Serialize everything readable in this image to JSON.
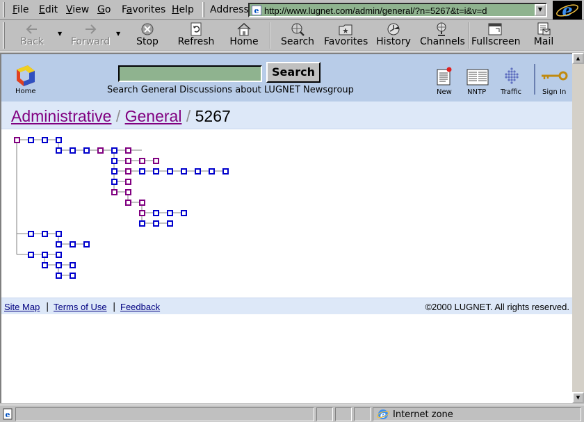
{
  "menu": [
    "File",
    "Edit",
    "View",
    "Go",
    "Favorites",
    "Help"
  ],
  "menu_mnemonics": [
    "F",
    "E",
    "V",
    "G",
    "a",
    "H"
  ],
  "address": {
    "label": "Address",
    "url": "http://www.lugnet.com/admin/general/?n=5267&t=i&v=d"
  },
  "toolbar": {
    "back": "Back",
    "forward": "Forward",
    "stop": "Stop",
    "refresh": "Refresh",
    "home": "Home",
    "search": "Search",
    "favorites": "Favorites",
    "history": "History",
    "channels": "Channels",
    "fullscreen": "Fullscreen",
    "mail": "Mail"
  },
  "header": {
    "home_label": "Home",
    "search_button": "Search",
    "search_caption": "Search General Discussions about LUGNET Newsgroup",
    "search_value": "",
    "nav": [
      "New",
      "NNTP",
      "Traffic",
      "Sign In"
    ]
  },
  "breadcrumb": {
    "items": [
      "Administrative",
      "General"
    ],
    "current": "5267",
    "separator": "/"
  },
  "footer": {
    "links": [
      "Site Map",
      "Terms of Use",
      "Feedback"
    ],
    "separator": "|",
    "copyright": "©2000 LUGNET. All rights reserved."
  },
  "status": {
    "zone": "Internet zone"
  },
  "colors": {
    "unread_node": "#0000cc",
    "read_node": "#800080",
    "header_bg": "#b8cce8",
    "link": "#800080"
  },
  "icons": [
    "ie-page-icon",
    "back-arrow-icon",
    "forward-arrow-icon",
    "stop-icon",
    "refresh-icon",
    "home-icon",
    "search-globe-icon",
    "favorites-icon",
    "history-icon",
    "channels-icon",
    "fullscreen-icon",
    "mail-icon",
    "lugnet-logo-icon",
    "new-icon",
    "nntp-icon",
    "traffic-icon",
    "key-icon",
    "ie-logo-icon"
  ]
}
